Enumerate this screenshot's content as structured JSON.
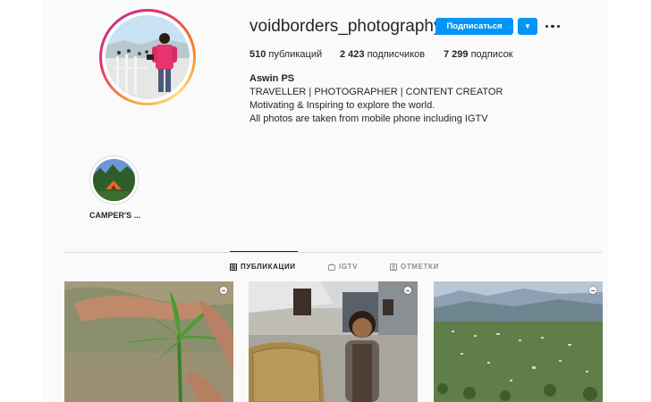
{
  "profile": {
    "username": "voidborders_photography",
    "subscribe_label": "Подписаться",
    "dropdown_symbol": "▼",
    "full_name": "Aswin PS",
    "bio": [
      "TRAVELLER | PHOTOGRAPHER | CONTENT CREATOR",
      "Motivating & Inspiring to explore the world.",
      "All photos are taken from mobile phone including IGTV"
    ]
  },
  "stats": {
    "posts": {
      "count": "510",
      "label": "публикаций"
    },
    "followers": {
      "count": "2 423",
      "label": "подписчиков"
    },
    "following": {
      "count": "7 299",
      "label": "подписок"
    }
  },
  "highlights": [
    {
      "label": "CAMPER'S ..."
    }
  ],
  "tabs": [
    {
      "label": "ПУБЛИКАЦИИ",
      "icon": "grid-icon",
      "active": true
    },
    {
      "label": "IGTV",
      "icon": "igtv-icon",
      "active": false
    },
    {
      "label": "ОТМЕТКИ",
      "icon": "tagged-icon",
      "active": false
    }
  ],
  "posts": [
    {
      "subject": "hand holding cannabis plant",
      "type": "video"
    },
    {
      "subject": "smiling girl with basket in village",
      "type": "video"
    },
    {
      "subject": "mountain valley landscape",
      "type": "video"
    }
  ],
  "colors": {
    "accent": "#0095f6",
    "text": "#262626",
    "secondary_text": "#8e8e8e",
    "divider": "#dbdbdb",
    "background": "#fafafa"
  }
}
